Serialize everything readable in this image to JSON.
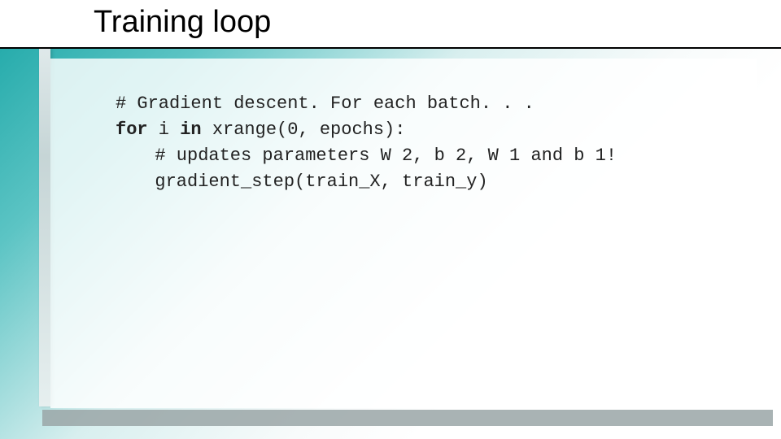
{
  "title": "Training loop",
  "code": {
    "line1": "# Gradient descent. For each batch. . .",
    "line2_kw1": "for",
    "line2_mid": " i ",
    "line2_kw2": "in",
    "line2_tail": " xrange(0, epochs):",
    "line3": "# updates parameters W 2, b 2, W 1 and b 1!",
    "line4": "gradient_step(train_X, train_y)"
  }
}
